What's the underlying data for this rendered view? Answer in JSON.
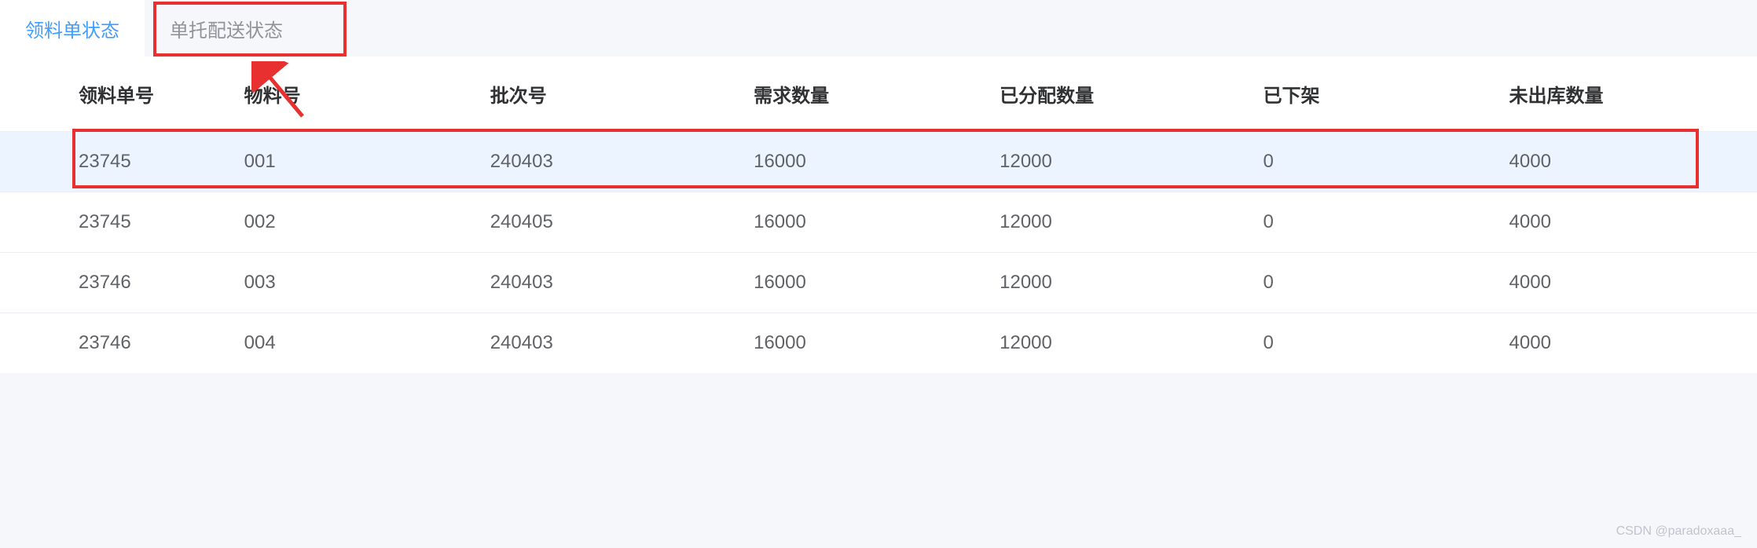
{
  "tabs": [
    {
      "label": "领料单状态",
      "active": true
    },
    {
      "label": "单托配送状态",
      "active": false
    }
  ],
  "table": {
    "headers": [
      "领料单号",
      "物料号",
      "批次号",
      "需求数量",
      "已分配数量",
      "已下架",
      "未出库数量"
    ],
    "rows": [
      {
        "order_no": "23745",
        "material_no": "001",
        "batch_no": "240403",
        "demand_qty": "16000",
        "allocated_qty": "12000",
        "removed_qty": "0",
        "pending_qty": "4000",
        "highlighted": true
      },
      {
        "order_no": "23745",
        "material_no": "002",
        "batch_no": "240405",
        "demand_qty": "16000",
        "allocated_qty": "12000",
        "removed_qty": "0",
        "pending_qty": "4000",
        "highlighted": false
      },
      {
        "order_no": "23746",
        "material_no": "003",
        "batch_no": "240403",
        "demand_qty": "16000",
        "allocated_qty": "12000",
        "removed_qty": "0",
        "pending_qty": "4000",
        "highlighted": false
      },
      {
        "order_no": "23746",
        "material_no": "004",
        "batch_no": "240403",
        "demand_qty": "16000",
        "allocated_qty": "12000",
        "removed_qty": "0",
        "pending_qty": "4000",
        "highlighted": false
      }
    ]
  },
  "watermark": "CSDN @paradoxaaa_"
}
